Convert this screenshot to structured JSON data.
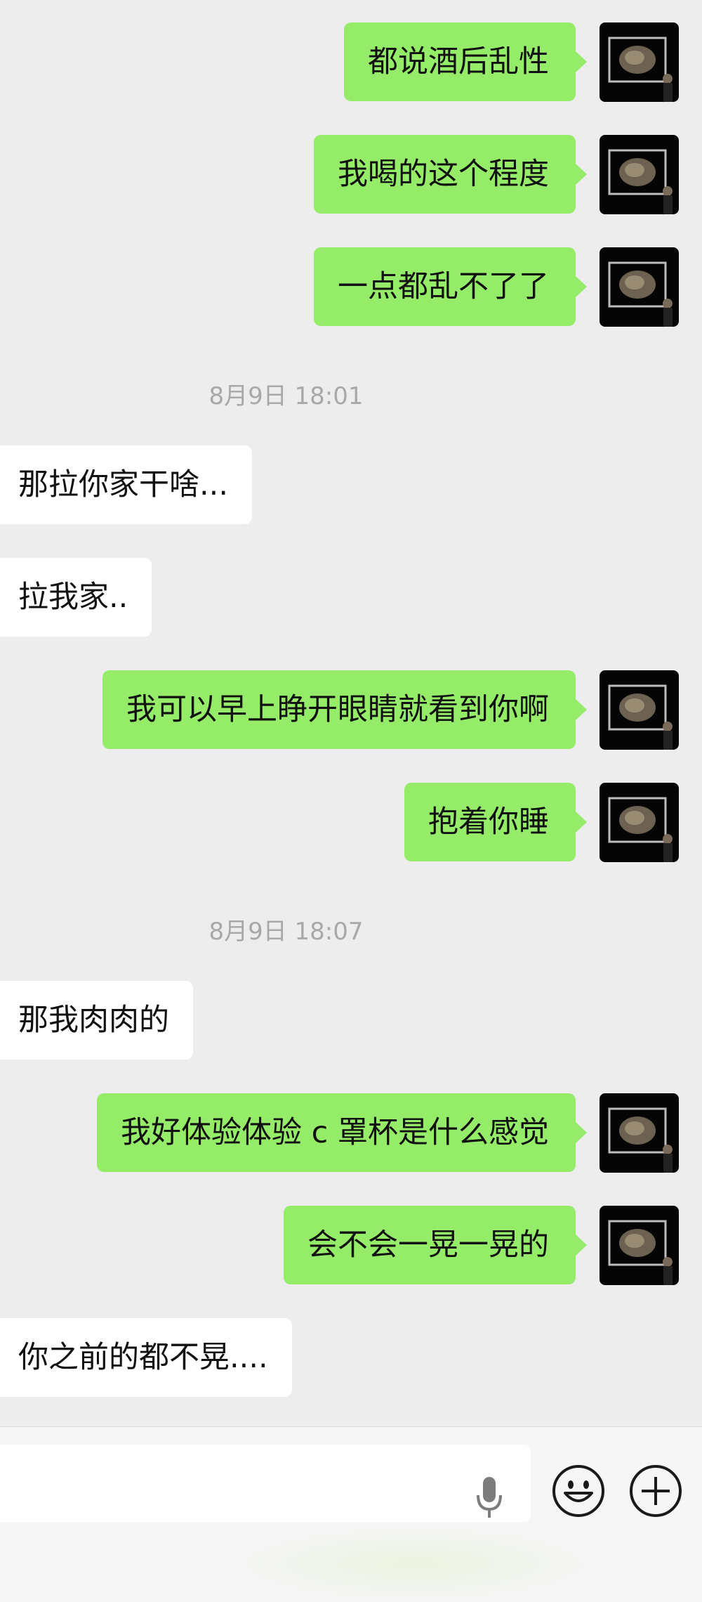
{
  "messages": [
    {
      "side": "me",
      "text": "都说酒后乱性"
    },
    {
      "side": "me",
      "text": "我喝的这个程度"
    },
    {
      "side": "me",
      "text": "一点都乱不了了"
    },
    {
      "type": "time",
      "text": "8月9日 18:01"
    },
    {
      "side": "them",
      "text": "那拉你家干啥..."
    },
    {
      "side": "them",
      "text": "拉我家.."
    },
    {
      "side": "me",
      "text": "我可以早上睁开眼睛就看到你啊"
    },
    {
      "side": "me",
      "text": "抱着你睡"
    },
    {
      "type": "time",
      "text": "8月9日 18:07"
    },
    {
      "side": "them",
      "text": "那我肉肉的"
    },
    {
      "side": "me",
      "text": "我好体验体验 c 罩杯是什么感觉"
    },
    {
      "side": "me",
      "text": "会不会一晃一晃的"
    },
    {
      "side": "them",
      "text": "你之前的都不晃...."
    }
  ],
  "input": {
    "value": "",
    "placeholder": "",
    "voice_icon": "microphone-icon",
    "emoji_icon": "emoji-smile-icon",
    "more_icon": "plus-circle-icon"
  },
  "colors": {
    "background": "#ededed",
    "my_bubble": "#95ec69",
    "their_bubble": "#ffffff",
    "timestamp_text": "#a8a8a8"
  }
}
